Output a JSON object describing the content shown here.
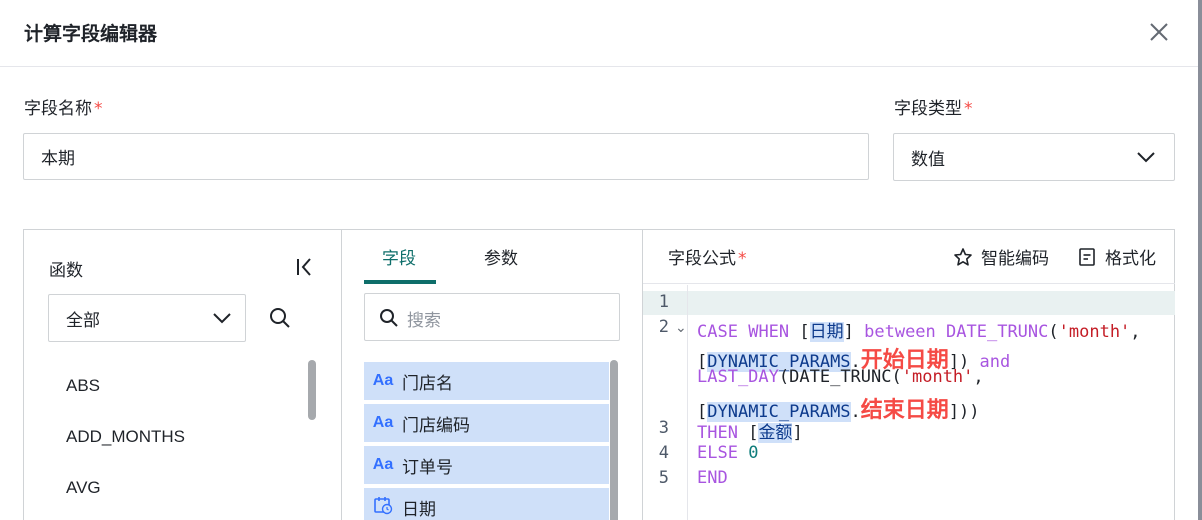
{
  "dialog": {
    "title": "计算字段编辑器",
    "close_icon": "close-icon"
  },
  "form": {
    "name_label": "字段名称",
    "required_mark": "*",
    "name_value": "本期",
    "type_label": "字段类型",
    "type_value": "数值"
  },
  "functions": {
    "title": "函数",
    "category_value": "全部",
    "items": [
      "ABS",
      "ADD_MONTHS",
      "AVG"
    ]
  },
  "fields_panel": {
    "tabs": [
      "字段",
      "参数"
    ],
    "active_tab": "字段",
    "search_placeholder": "搜索",
    "items": [
      {
        "type_icon": "text-type-icon",
        "glyph": "Aa",
        "label": "门店名"
      },
      {
        "type_icon": "text-type-icon",
        "glyph": "Aa",
        "label": "门店编码"
      },
      {
        "type_icon": "text-type-icon",
        "glyph": "Aa",
        "label": "订单号"
      },
      {
        "type_icon": "date-type-icon",
        "glyph": "",
        "label": "日期"
      }
    ]
  },
  "formula": {
    "title": "字段公式",
    "smart_code_label": "智能编码",
    "format_label": "格式化",
    "line_numbers": [
      "1",
      "2",
      "3",
      "4",
      "5"
    ],
    "tokens": {
      "case": "CASE",
      "when": "WHEN",
      "date_field": "日期",
      "between": "between",
      "date_trunc": "DATE_TRUNC",
      "month_str": "'month'",
      "dynamic_params": "DYNAMIC_PARAMS",
      "and": "and",
      "last_day": "LAST_DAY",
      "then": "THEN",
      "amount_field": "金额",
      "else": "ELSE",
      "zero": "0",
      "end": "END"
    },
    "annotations": {
      "start_date": "开始日期",
      "end_date": "结束日期"
    },
    "colors": {
      "keyword": "#a855e0",
      "string": "#c41d26",
      "number": "#0e7c7b",
      "annotation": "#f54a45"
    }
  }
}
